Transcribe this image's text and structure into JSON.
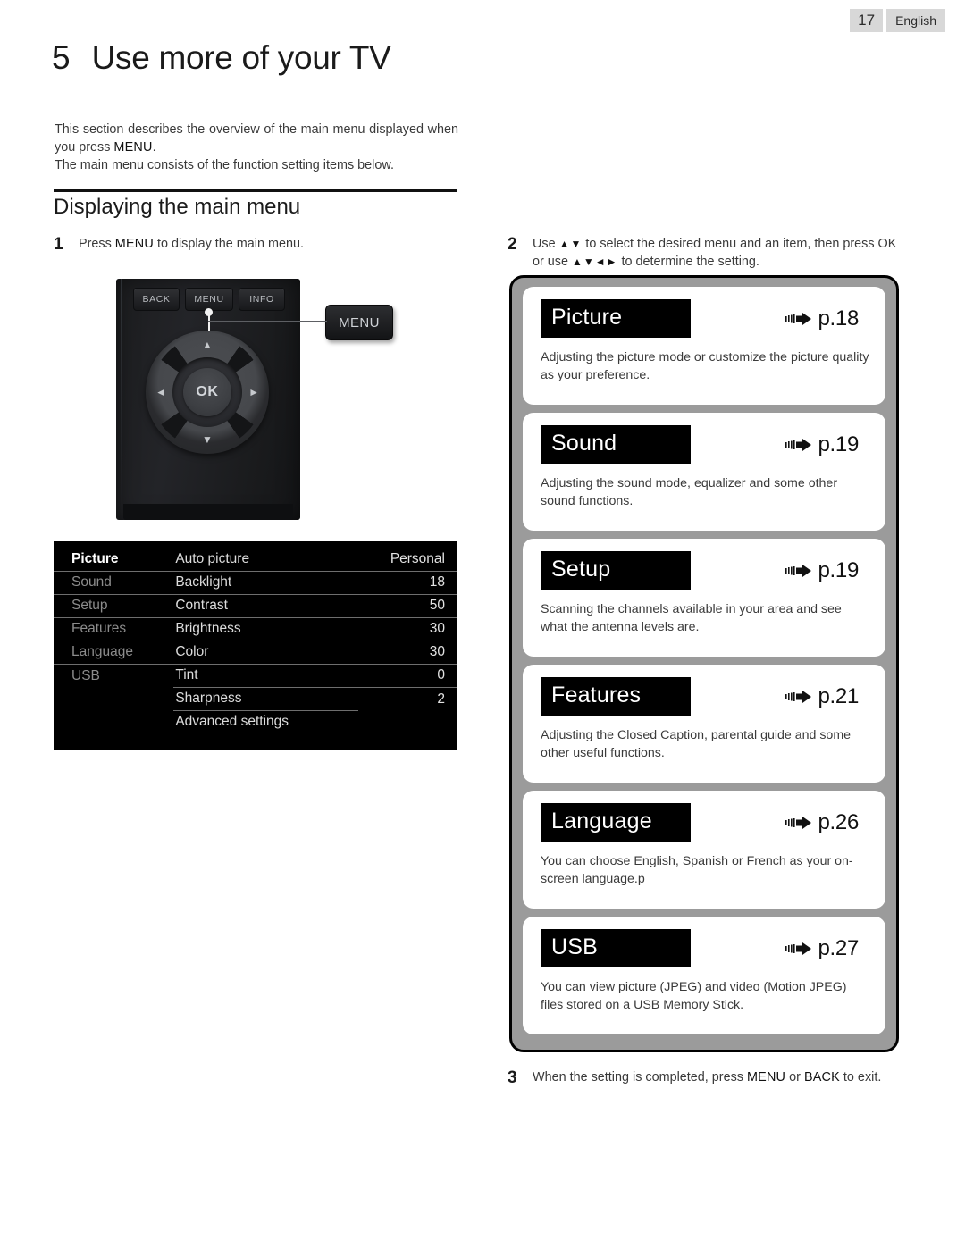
{
  "header": {
    "page_number": "17",
    "language": "English"
  },
  "chapter": {
    "number": "5",
    "title": "Use more of your TV"
  },
  "intro": {
    "line1_a": "This section describes the overview of the main menu displayed when you press ",
    "line1_kw": "MENU",
    "line1_b": ".",
    "line2": "The main menu consists of the function setting items below."
  },
  "section": {
    "title": "Displaying the main menu"
  },
  "steps": {
    "step1": {
      "num": "1",
      "text_a": "Press ",
      "kw": "MENU",
      "text_b": " to display the main menu."
    },
    "step2": {
      "num": "2",
      "line1_a": "Use ",
      "line1_arrows": "▲▼",
      "line1_b": " to select the desired menu and an item, then press OK",
      "line2_a": "or use ",
      "line2_arrows": "▲▼◄►",
      "line2_b": " to determine the setting."
    },
    "step3": {
      "num": "3",
      "text_a": "When the setting is completed, press ",
      "kw1": "MENU",
      "text_b": " or ",
      "kw2": "BACK",
      "text_c": " to exit."
    }
  },
  "remote": {
    "buttons": {
      "back": "BACK",
      "menu": "MENU",
      "info": "INFO"
    },
    "ok_label": "OK",
    "dpad": {
      "up": "▲",
      "down": "▼",
      "left": "◄",
      "right": "►"
    },
    "callout_label": "MENU"
  },
  "osd": {
    "left_column": [
      {
        "label": "Picture",
        "selected": true
      },
      {
        "label": "Sound",
        "selected": false
      },
      {
        "label": "Setup",
        "selected": false
      },
      {
        "label": "Features",
        "selected": false
      },
      {
        "label": "Language",
        "selected": false
      },
      {
        "label": "USB",
        "selected": false
      }
    ],
    "rows": [
      {
        "item": "Auto picture",
        "value": "Personal"
      },
      {
        "item": "Backlight",
        "value": "18"
      },
      {
        "item": "Contrast",
        "value": "50"
      },
      {
        "item": "Brightness",
        "value": "30"
      },
      {
        "item": "Color",
        "value": "30"
      },
      {
        "item": "Tint",
        "value": "0"
      },
      {
        "item": "Sharpness",
        "value": "2"
      },
      {
        "item": "Advanced settings",
        "value": ""
      }
    ]
  },
  "overview": {
    "cards": [
      {
        "label": "Picture",
        "page": "p.18",
        "desc": "Adjusting the picture mode or customize the picture quality as your preference."
      },
      {
        "label": "Sound",
        "page": "p.19",
        "desc": "Adjusting the sound mode, equalizer and some other sound functions."
      },
      {
        "label": "Setup",
        "page": "p.19",
        "desc": "Scanning the channels available in your area and see what the antenna levels are."
      },
      {
        "label": "Features",
        "page": "p.21",
        "desc": "Adjusting the Closed Caption, parental guide and some other useful functions."
      },
      {
        "label": "Language",
        "page": "p.26",
        "desc": "You can choose English, Spanish or French as your on-screen language.p"
      },
      {
        "label": "USB",
        "page": "p.27",
        "desc": "You can view picture (JPEG) and video (Motion JPEG) files stored on a USB Memory Stick."
      }
    ]
  },
  "colors": {
    "page_badge_bg": "#d8d8d8",
    "panel_gray": "#9b9b9b",
    "label_black": "#000000",
    "osd_bg": "#000000"
  }
}
